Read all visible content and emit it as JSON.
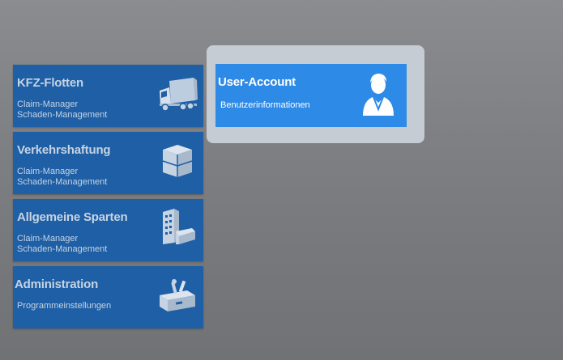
{
  "tiles": [
    {
      "title": "KFZ-Flotten",
      "lines": [
        "Claim-Manager",
        "Schaden-Management"
      ],
      "icon": "truck-icon"
    },
    {
      "title": "Verkehrshaftung",
      "lines": [
        "Claim-Manager",
        "Schaden-Management"
      ],
      "icon": "box-icon"
    },
    {
      "title": "Allgemeine Sparten",
      "lines": [
        "Claim-Manager",
        "Schaden-Management"
      ],
      "icon": "buildings-icon"
    },
    {
      "title": "Administration",
      "lines": [
        "Programmeinstellungen"
      ],
      "icon": "toolbox-icon"
    }
  ],
  "user_tile": {
    "title": "User-Account",
    "subtitle": "Benutzerinformationen",
    "icon": "user-icon"
  },
  "colors": {
    "tile_bg": "#1e5fa5",
    "active_tile_bg": "#2d8ae6",
    "highlight_frame": "#c6ccd3",
    "tile_text": "#c6d3e3"
  }
}
